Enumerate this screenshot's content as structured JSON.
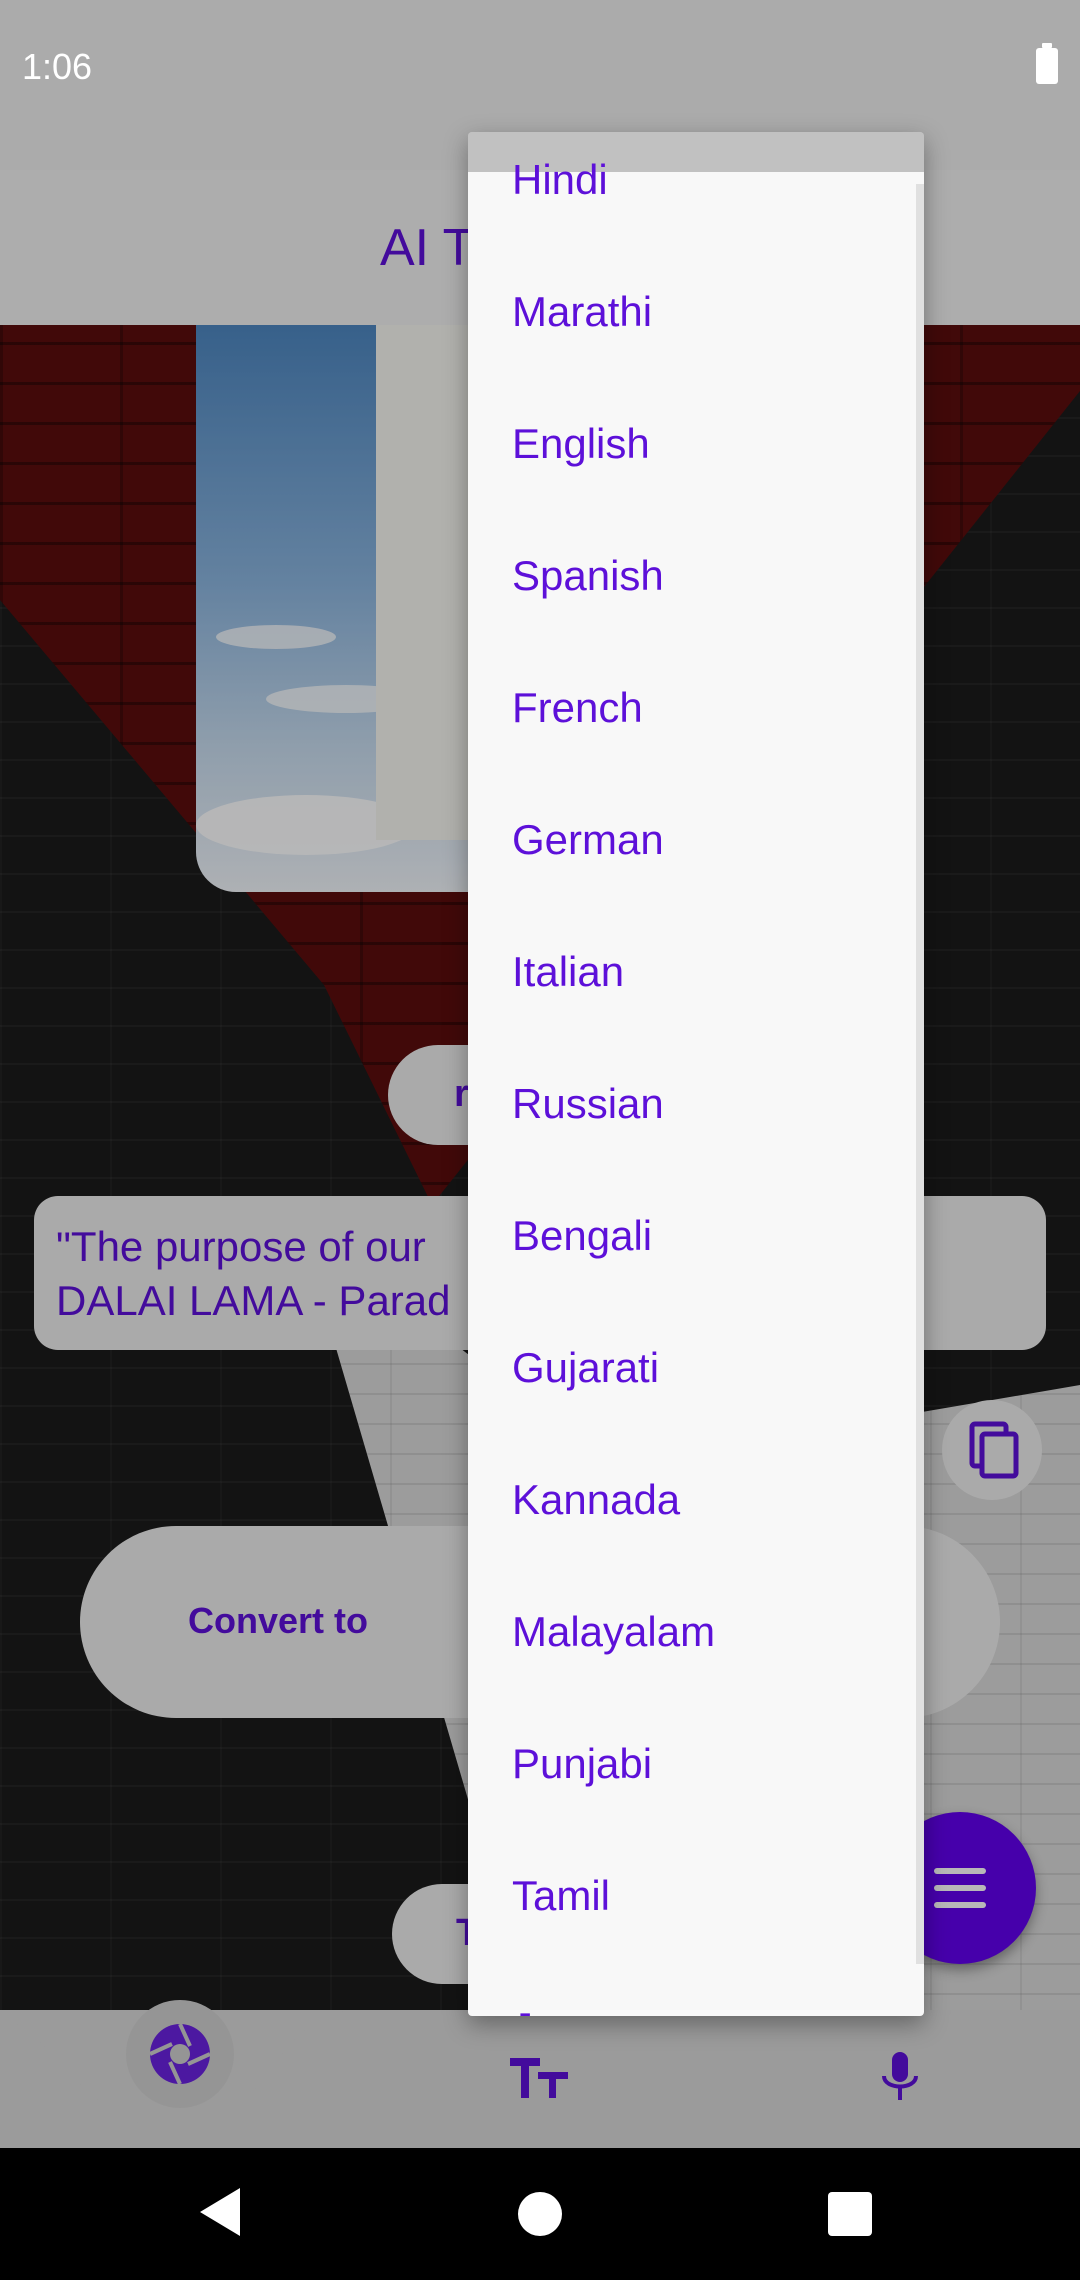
{
  "status_bar": {
    "time": "1:06"
  },
  "app_bar": {
    "title": "AI T"
  },
  "buttons": {
    "top_pill_fragment": "r",
    "convert_label": "Convert to",
    "bottom_pill_fragment": "T"
  },
  "result": {
    "text": "\"The purpose of our\nDALAI LAMA - Parad"
  },
  "dropdown": {
    "languages": [
      "Hindi",
      "Marathi",
      "English",
      "Spanish",
      "French",
      "German",
      "Italian",
      "Russian",
      "Bengali",
      "Gujarati",
      "Kannada",
      "Malayalam",
      "Punjabi",
      "Tamil",
      "Japanese"
    ]
  },
  "colors": {
    "accent": "#5d10d9",
    "fab": "#6200ee"
  }
}
